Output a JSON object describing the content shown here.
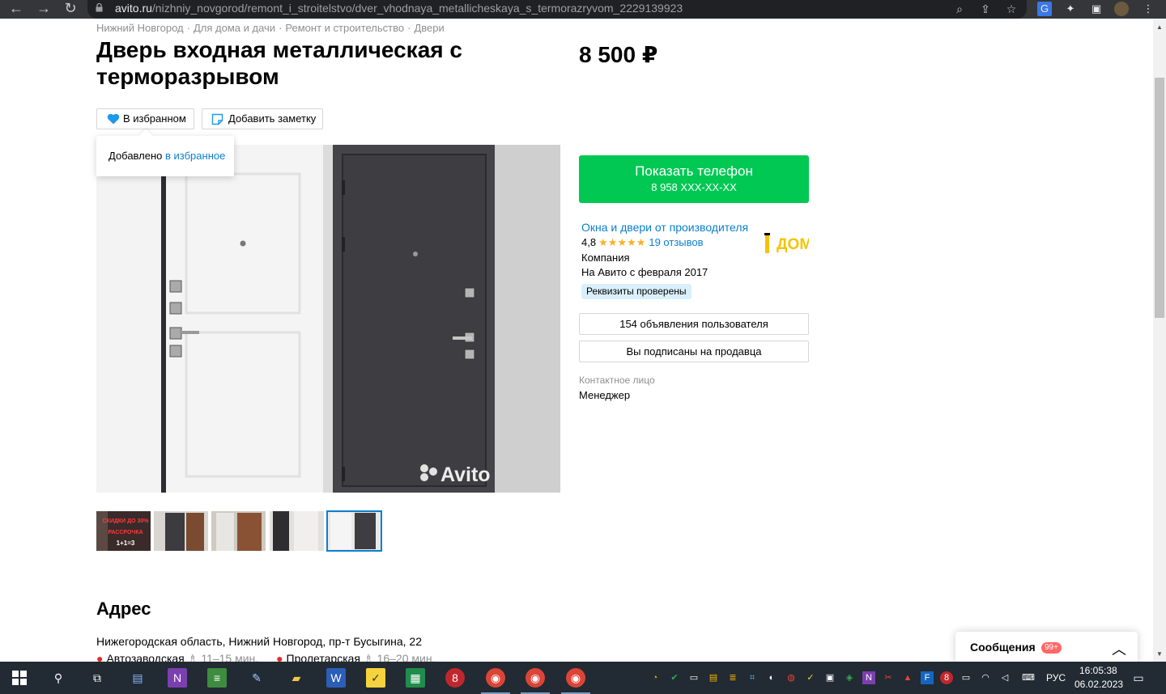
{
  "browser": {
    "url_domain": "avito.ru",
    "url_path": "/nizhniy_novgorod/remont_i_stroitelstvo/dver_vhodnaya_metallicheskaya_s_termorazryvom_2229139923"
  },
  "breadcrumb": [
    "Нижний Новгород",
    "Для дома и дачи",
    "Ремонт и строительство",
    "Двери"
  ],
  "breadcrumb_sep": "·",
  "listing": {
    "title": "Дверь входная металлическая с терморазрывом",
    "price": "8 500 ₽",
    "fav_button": "В избранном",
    "note_button": "Добавить заметку",
    "tooltip_text": "Добавлено",
    "tooltip_link": "в избранное",
    "watermark": "Avito"
  },
  "thumbnail_text": [
    "СКИДКИ ДО 30%",
    "РАССРОЧКА",
    "1+1=3"
  ],
  "seller": {
    "show_phone": "Показать телефон",
    "phone_masked": "8 958 XXX-XX-XX",
    "name": "Окна и двери от производителя",
    "rating": "4,8",
    "stars": "★★★★★",
    "reviews": "19 отзывов",
    "type": "Компания",
    "since": "На Авито с февраля 2017",
    "verified": "Реквизиты проверены",
    "logo_text": "ДОМ",
    "listings_button": "154 объявления пользователя",
    "subscribed_button": "Вы подписаны на продавца",
    "contact_label": "Контактное лицо",
    "contact_name": "Менеджер"
  },
  "address": {
    "title": "Адрес",
    "text": "Нижегородская область, Нижний Новгород, пр-т Бусыгина, 22",
    "metro": [
      {
        "name": "Автозаводская",
        "time": "11–15 мин."
      },
      {
        "name": "Пролетарская",
        "time": "16–20 мин."
      }
    ]
  },
  "messages": {
    "label": "Сообщения",
    "badge": "99+"
  },
  "taskbar": {
    "lang": "РУС",
    "time": "16:05:38",
    "date": "06.02.2023"
  },
  "colors": {
    "accent_blue": "#0a7fce",
    "phone_green": "#00c853",
    "star": "#ffb021"
  }
}
